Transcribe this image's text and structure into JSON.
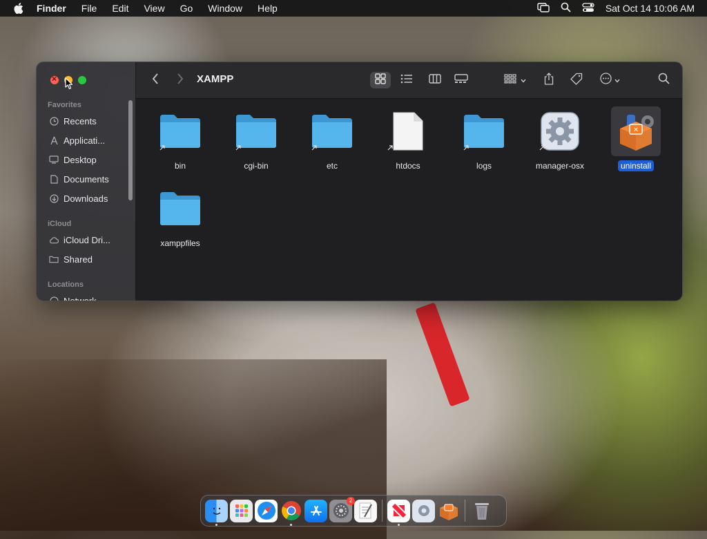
{
  "menubar": {
    "app_name": "Finder",
    "items": [
      "File",
      "Edit",
      "View",
      "Go",
      "Window",
      "Help"
    ],
    "clock": "Sat Oct 14  10:06 AM"
  },
  "window": {
    "title": "XAMPP",
    "sidebar": {
      "favorites_label": "Favorites",
      "favorites": [
        {
          "label": "Recents",
          "icon": "clock-icon"
        },
        {
          "label": "Applicati...",
          "icon": "applications-icon"
        },
        {
          "label": "Desktop",
          "icon": "desktop-icon"
        },
        {
          "label": "Documents",
          "icon": "document-icon"
        },
        {
          "label": "Downloads",
          "icon": "download-icon"
        }
      ],
      "icloud_label": "iCloud",
      "icloud": [
        {
          "label": "iCloud Dri...",
          "icon": "cloud-icon"
        },
        {
          "label": "Shared",
          "icon": "shared-folder-icon"
        }
      ],
      "locations_label": "Locations",
      "locations": [
        {
          "label": "Network",
          "icon": "network-icon"
        }
      ]
    },
    "files": [
      {
        "name": "bin",
        "type": "folder-alias"
      },
      {
        "name": "cgi-bin",
        "type": "folder-alias"
      },
      {
        "name": "etc",
        "type": "folder-alias"
      },
      {
        "name": "htdocs",
        "type": "file-alias"
      },
      {
        "name": "logs",
        "type": "folder-alias"
      },
      {
        "name": "manager-osx",
        "type": "app-alias"
      },
      {
        "name": "uninstall",
        "type": "app",
        "selected": true
      },
      {
        "name": "xamppfiles",
        "type": "folder"
      }
    ]
  },
  "dock": {
    "apps": [
      "Finder",
      "Launchpad",
      "Safari",
      "Chrome",
      "App Store",
      "System Settings",
      "TextEdit",
      "News",
      "manager-osx",
      "XAMPP",
      "Trash"
    ],
    "settings_badge": "2"
  },
  "colors": {
    "folder": "#47a9e6",
    "selection": "#1f5fd6",
    "close": "#ff5f57",
    "minimize": "#febc2e",
    "maximize": "#28c840"
  }
}
